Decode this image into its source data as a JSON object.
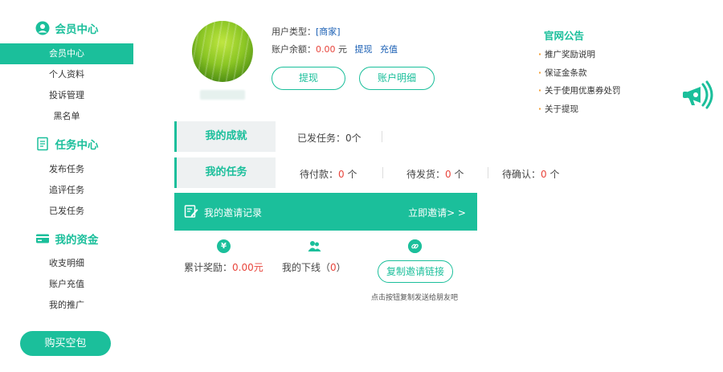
{
  "colors": {
    "accent": "#1bbf9b",
    "highlight_value": "#e8453c",
    "link": "#1a5fb4",
    "bullet": "#f29b2e"
  },
  "sidebar": {
    "member_center": {
      "title": "会员中心",
      "icon": "user-circle-icon",
      "items": [
        "会员中心",
        "个人资料",
        "投诉管理",
        "黑名单"
      ]
    },
    "task_center": {
      "title": "任务中心",
      "icon": "document-list-icon",
      "items": [
        "发布任务",
        "追评任务",
        "已发任务"
      ]
    },
    "funds": {
      "title": "我的资金",
      "icon": "card-icon",
      "items": [
        "收支明细",
        "账户充值",
        "我的推广"
      ]
    },
    "buy_button": "购买空包"
  },
  "profile": {
    "user_type_label": "用户类型：",
    "user_type_value": "[商家]",
    "balance_label": "账户余额：",
    "balance_value": "0.00",
    "balance_unit": "元",
    "withdraw_link": "提现",
    "recharge_link": "充值",
    "withdraw_button": "提现",
    "account_detail_button": "账户明细"
  },
  "announcements": {
    "title": "官网公告",
    "items": [
      "推广奖励说明",
      "保证金条款",
      "关于使用优惠券处罚",
      "关于提现"
    ],
    "icon": "megaphone-icon"
  },
  "achievements": {
    "title": "我的成就",
    "published_label": "已发任务：",
    "published_value": "0",
    "unit": "个"
  },
  "tasks": {
    "title": "我的任务",
    "pending_payment_label": "待付款：",
    "pending_payment_value": "0",
    "pending_shipment_label": "待发货：",
    "pending_shipment_value": "0",
    "pending_confirm_label": "待确认：",
    "pending_confirm_value": "0",
    "unit": "个"
  },
  "invite": {
    "title": "我的邀请记录",
    "action": "立即邀请> >",
    "reward_label": "累计奖励：",
    "reward_value": "0.00元",
    "downline_label": "我的下线（",
    "downline_value": "0",
    "downline_close": "）",
    "copy_button": "复制邀请链接",
    "copy_hint": "点击按钮复制发送给朋友吧"
  }
}
